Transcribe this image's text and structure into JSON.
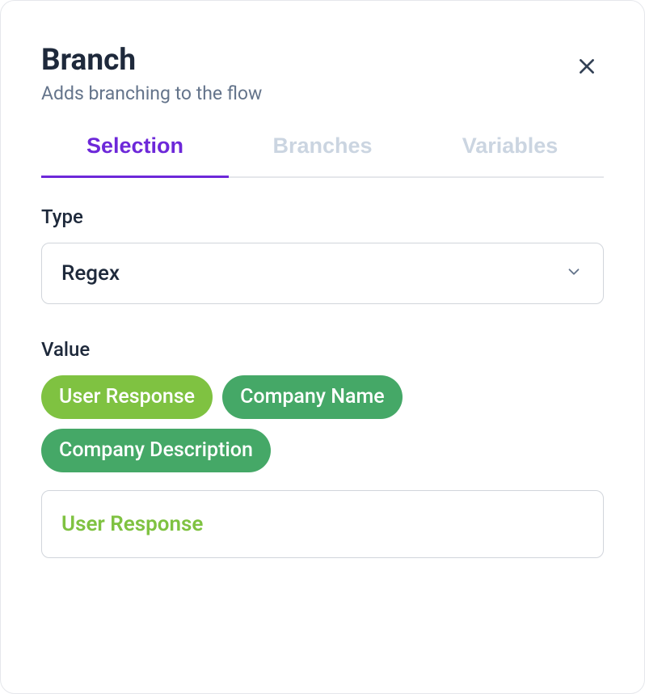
{
  "header": {
    "title": "Branch",
    "subtitle": "Adds branching to the flow"
  },
  "tabs": [
    {
      "label": "Selection",
      "active": true
    },
    {
      "label": "Branches",
      "active": false
    },
    {
      "label": "Variables",
      "active": false
    }
  ],
  "fields": {
    "type": {
      "label": "Type",
      "selected": "Regex"
    },
    "value": {
      "label": "Value",
      "chips": [
        {
          "label": "User Response",
          "style": "green-light"
        },
        {
          "label": "Company Name",
          "style": "green-dark"
        },
        {
          "label": "Company Description",
          "style": "green-dark"
        }
      ],
      "input": "User Response"
    }
  }
}
